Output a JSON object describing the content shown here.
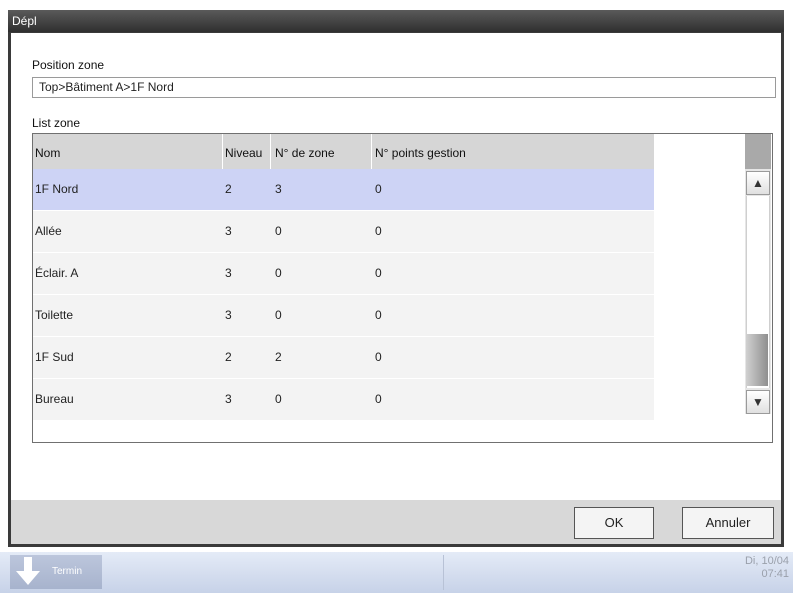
{
  "window": {
    "title": "Dépl"
  },
  "position": {
    "label": "Position zone",
    "value": "Top>Bâtiment A>1F Nord"
  },
  "list": {
    "label": "List zone",
    "columns": [
      "Nom",
      "Niveau",
      "N° de zone",
      "N° points gestion"
    ],
    "rows": [
      {
        "nom": "1F Nord",
        "niveau": "2",
        "zone": "3",
        "points": "0",
        "selected": true
      },
      {
        "nom": "Allée",
        "niveau": "3",
        "zone": "0",
        "points": "0"
      },
      {
        "nom": "Éclair. A",
        "niveau": "3",
        "zone": "0",
        "points": "0"
      },
      {
        "nom": "Toilette",
        "niveau": "3",
        "zone": "0",
        "points": "0"
      },
      {
        "nom": "1F Sud",
        "niveau": "2",
        "zone": "2",
        "points": "0"
      },
      {
        "nom": "Bureau",
        "niveau": "3",
        "zone": "0",
        "points": "0"
      }
    ]
  },
  "buttons": {
    "ok": "OK",
    "cancel": "Annuler"
  },
  "taskbar": {
    "left_button": "Termin",
    "date": "Di, 10/04",
    "time": "07:41"
  },
  "icons": {
    "scroll_up": "triangle-up-icon",
    "scroll_down": "triangle-down-icon",
    "taskbar": "arrow-down-icon"
  },
  "colors": {
    "selected_row": "#cdd3f5",
    "header": "#d6d6d6",
    "frame": "#3a3a3a"
  }
}
